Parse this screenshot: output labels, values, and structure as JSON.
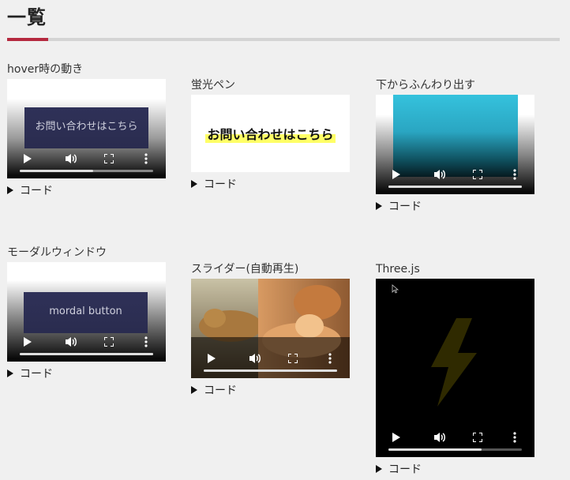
{
  "page": {
    "title": "一覧"
  },
  "code_label": "コード",
  "cards": {
    "hover": {
      "label": "hover時の動き",
      "button_text": "お問い合わせはこちら",
      "progress": 0.55
    },
    "marker": {
      "label": "蛍光ペン",
      "text": "お問い合わせはこちら"
    },
    "fade": {
      "label": "下からふんわり出す",
      "progress": 1.0
    },
    "modal": {
      "label": "モーダルウィンドウ",
      "button_text": "mordal button",
      "progress": 1.0
    },
    "slider": {
      "label": "スライダー(自動再生)",
      "progress": 1.0
    },
    "three": {
      "label": "Three.js",
      "progress": 0.7
    }
  },
  "colors": {
    "accent": "#b5293f",
    "marker": "#ffff66",
    "navy": "#2f3158",
    "bolt": "#3a3300"
  }
}
